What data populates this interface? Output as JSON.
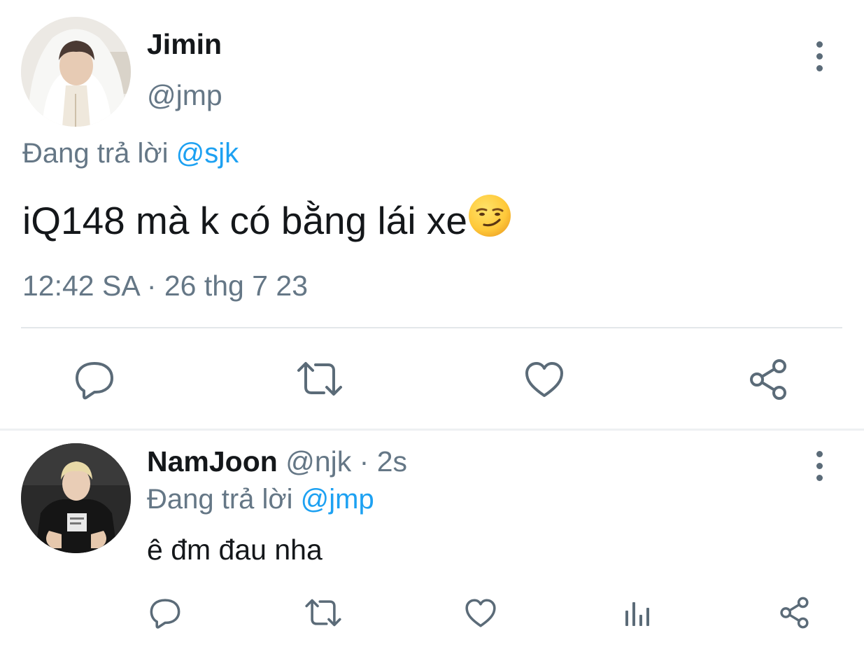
{
  "main_tweet": {
    "display_name": "Jimin",
    "handle": "@jmp",
    "replying_prefix": "Đang trả lời",
    "replying_to": "@sjk",
    "text": "iQ148 mà k có bằng lái xe",
    "text_emoji": "smirking-face-emoji",
    "timestamp": "12:42 SA · 26 thg 7 23",
    "actions": [
      "reply-icon",
      "retweet-icon",
      "like-icon",
      "share-icon"
    ]
  },
  "reply_tweet": {
    "display_name": "NamJoon",
    "handle": "@njk",
    "separator": "·",
    "time": "2s",
    "replying_prefix": "Đang trả lời",
    "replying_to": "@jmp",
    "text": "ê đm đau nha",
    "actions": [
      "reply-icon",
      "retweet-icon",
      "like-icon",
      "analytics-icon",
      "share-icon"
    ]
  },
  "colors": {
    "text_primary": "#14171a",
    "text_secondary": "#657786",
    "accent": "#1da1f2",
    "icon": "#5b6b78",
    "divider": "#e3e7ea"
  }
}
